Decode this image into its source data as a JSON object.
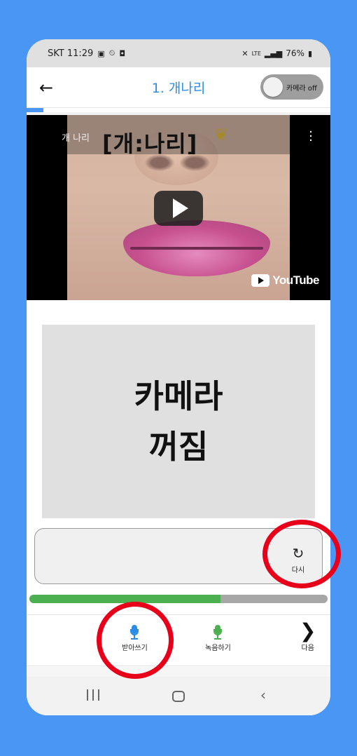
{
  "status_bar": {
    "carrier_time": "SKT 11:29",
    "icons": [
      "gallery-icon",
      "alarm-icon",
      "camera-icon",
      "mute-icon",
      "lte-icon",
      "signal-icon",
      "battery-icon"
    ],
    "lte": "LTE",
    "battery": "76%"
  },
  "app_bar": {
    "title": "1. 개나리",
    "camera_toggle_label": "카메라 off",
    "camera_toggle_state": "off"
  },
  "video": {
    "channel": "개 나리",
    "title": "[개:나리]",
    "brand": "YouTube"
  },
  "camera_panel": {
    "line1": "카메라",
    "line2": "꺼짐"
  },
  "result": {
    "text": "",
    "retry_icon": "↻",
    "retry_label": "다시"
  },
  "progress": {
    "percent": 64,
    "fill_color": "#4caf50",
    "track_color": "#a7a7a7"
  },
  "toolbar": {
    "dictation_label": "받아쓰기",
    "record_label": "녹음하기",
    "next_label": "다음",
    "dictation_mic_color": "#2b8ce6",
    "record_mic_color": "#4caf50"
  },
  "colors": {
    "background": "#4a96f5",
    "accent": "#2b8ce6",
    "highlight": "#e8001a"
  }
}
